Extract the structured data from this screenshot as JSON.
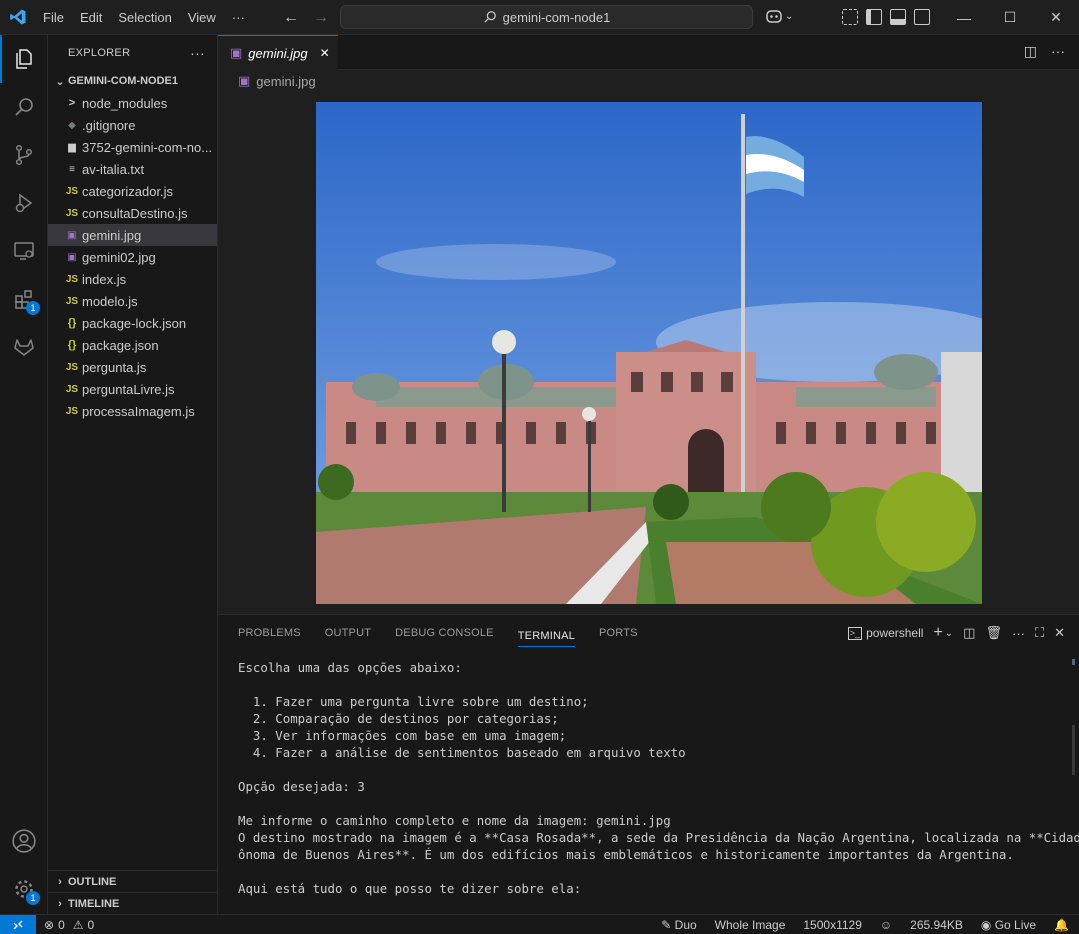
{
  "titlebar": {
    "menu": [
      "File",
      "Edit",
      "Selection",
      "View"
    ],
    "more": "···",
    "search_text": "gemini-com-node1"
  },
  "activity": {
    "extensions_badge": "1",
    "settings_badge": "1"
  },
  "sidebar": {
    "header": "EXPLORER",
    "more": "···",
    "folder": "GEMINI-COM-NODE1",
    "items": [
      {
        "label": "node_modules",
        "icon": "chevron-right-icon",
        "glyph": ">"
      },
      {
        "label": ".gitignore",
        "icon": "git-icon",
        "glyph": "◆"
      },
      {
        "label": "3752-gemini-com-no...",
        "icon": "file-icon",
        "glyph": "▆"
      },
      {
        "label": "av-italia.txt",
        "icon": "text-file-icon",
        "glyph": "≡"
      },
      {
        "label": "categorizador.js",
        "icon": "js-icon",
        "glyph": "JS"
      },
      {
        "label": "consultaDestino.js",
        "icon": "js-icon",
        "glyph": "JS"
      },
      {
        "label": "gemini.jpg",
        "icon": "image-file-icon",
        "glyph": "▣"
      },
      {
        "label": "gemini02.jpg",
        "icon": "image-file-icon",
        "glyph": "▣"
      },
      {
        "label": "index.js",
        "icon": "js-icon",
        "glyph": "JS"
      },
      {
        "label": "modelo.js",
        "icon": "js-icon",
        "glyph": "JS"
      },
      {
        "label": "package-lock.json",
        "icon": "json-icon",
        "glyph": "{}"
      },
      {
        "label": "package.json",
        "icon": "json-icon",
        "glyph": "{}"
      },
      {
        "label": "pergunta.js",
        "icon": "js-icon",
        "glyph": "JS"
      },
      {
        "label": "perguntaLivre.js",
        "icon": "js-icon",
        "glyph": "JS"
      },
      {
        "label": "processaImagem.js",
        "icon": "js-icon",
        "glyph": "JS"
      }
    ],
    "outline": "OUTLINE",
    "timeline": "TIMELINE"
  },
  "editor": {
    "tab_label": "gemini.jpg",
    "breadcrumb": "gemini.jpg"
  },
  "panel": {
    "tabs": [
      "PROBLEMS",
      "OUTPUT",
      "DEBUG CONSOLE",
      "TERMINAL",
      "PORTS"
    ],
    "active_tab": "TERMINAL",
    "shell": "powershell",
    "terminal_lines": [
      "Escolha uma das opções abaixo:",
      "",
      "  1. Fazer uma pergunta livre sobre um destino;",
      "  2. Comparação de destinos por categorias;",
      "  3. Ver informações com base em uma imagem;",
      "  4. Fazer a análise de sentimentos baseado em arquivo texto",
      "",
      "Opção desejada: 3",
      "",
      "Me informe o caminho completo e nome da imagem: gemini.jpg",
      "O destino mostrado na imagem é a **Casa Rosada**, a sede da Presidência da Nação Argentina, localizada na **Cidade Aut",
      "ônoma de Buenos Aires**. É um dos edifícios mais emblemáticos e historicamente importantes da Argentina.",
      "",
      "Aqui está tudo o que posso te dizer sobre ela:"
    ]
  },
  "statusbar": {
    "errors": "0",
    "warnings": "0",
    "theme": "Duo",
    "zoom_mode": "Whole Image",
    "dimensions": "1500x1129",
    "size": "265.94KB",
    "golive": "Go Live"
  },
  "colors": {
    "accent": "#0078d4",
    "background": "#1f1f1f",
    "sidebar": "#181818",
    "js_icon": "#cbcb41",
    "image_icon": "#a074c4"
  }
}
